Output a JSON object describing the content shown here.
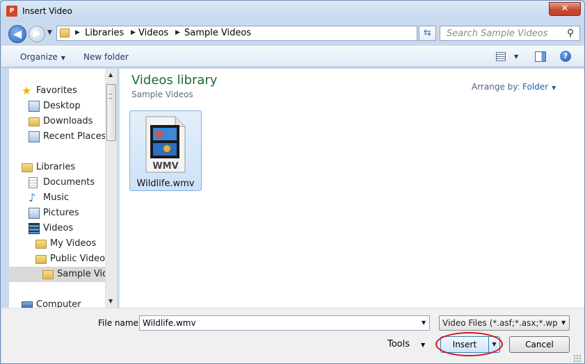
{
  "window": {
    "title": "Insert Video",
    "app_icon": "P",
    "close_label": "✕"
  },
  "address_bar": {
    "crumbs": [
      "Libraries",
      "Videos",
      "Sample Videos"
    ]
  },
  "search": {
    "placeholder": "Search Sample Videos"
  },
  "toolbar": {
    "organize_label": "Organize",
    "new_folder_label": "New folder"
  },
  "sidebar": {
    "items": [
      {
        "label": "Favorites",
        "icon": "star-icon"
      },
      {
        "label": "Desktop",
        "icon": "desktop-icon"
      },
      {
        "label": "Downloads",
        "icon": "folder-icon"
      },
      {
        "label": "Recent Places",
        "icon": "recent-places-icon"
      },
      {
        "label": "Libraries",
        "icon": "libraries-icon"
      },
      {
        "label": "Documents",
        "icon": "documents-icon"
      },
      {
        "label": "Music",
        "icon": "music-icon"
      },
      {
        "label": "Pictures",
        "icon": "pictures-icon"
      },
      {
        "label": "Videos",
        "icon": "videos-icon"
      },
      {
        "label": "My Videos",
        "icon": "folder-icon"
      },
      {
        "label": "Public Videos",
        "icon": "folder-icon"
      },
      {
        "label": "Sample Videos",
        "icon": "folder-icon",
        "selected": true
      },
      {
        "label": "Computer",
        "icon": "computer-icon"
      }
    ]
  },
  "content": {
    "library_title": "Videos library",
    "library_subtitle": "Sample Videos",
    "arrange_by_label": "Arrange by:",
    "arrange_by_value": "Folder",
    "files": [
      {
        "name": "Wildlife.wmv",
        "badge": "WMV",
        "selected": true
      }
    ]
  },
  "footer": {
    "file_name_label": "File name:",
    "file_name_value": "Wildlife.wmv",
    "file_type_value": "Video Files (*.asf;*.asx;*.wpl;*.wm",
    "tools_label": "Tools",
    "insert_label": "Insert",
    "cancel_label": "Cancel"
  },
  "colors": {
    "library_title": "#1e6a2e",
    "highlight_ring": "#d2101a",
    "selection_bg": "#cde2f8"
  }
}
